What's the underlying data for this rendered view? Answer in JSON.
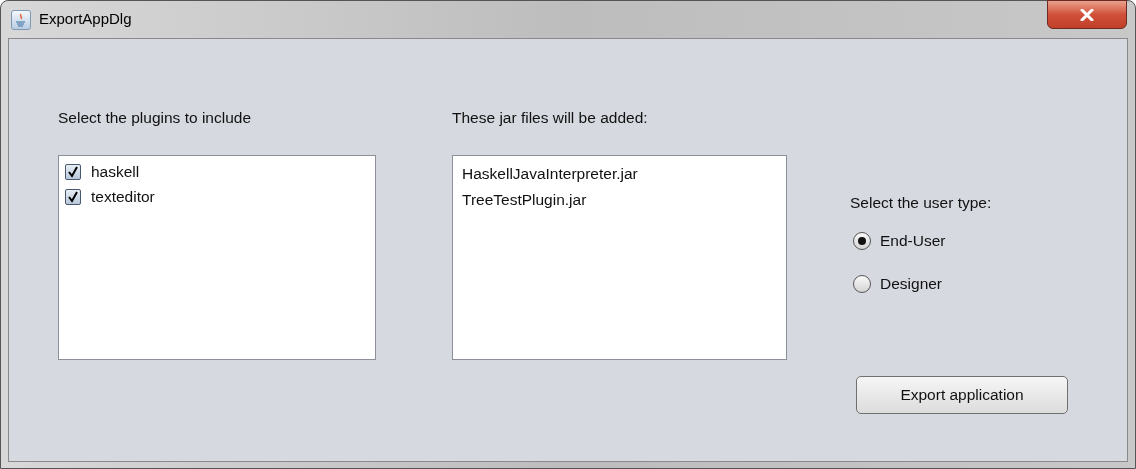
{
  "window": {
    "title": "ExportAppDlg"
  },
  "plugins": {
    "label": "Select the plugins to include",
    "items": [
      {
        "label": "haskell",
        "checked": true
      },
      {
        "label": "texteditor",
        "checked": true
      }
    ]
  },
  "jar_files": {
    "label": "These jar files will be added:",
    "items": [
      "HaskellJavaInterpreter.jar",
      "TreeTestPlugin.jar"
    ]
  },
  "user_type": {
    "label": "Select the user type:",
    "options": [
      {
        "label": "End-User",
        "selected": true
      },
      {
        "label": "Designer",
        "selected": false
      }
    ]
  },
  "export_button": "Export application"
}
